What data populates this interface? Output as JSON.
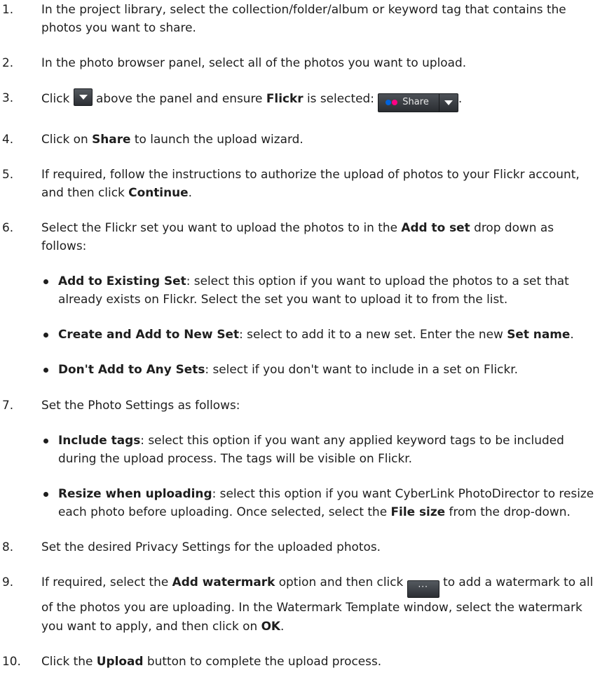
{
  "steps": [
    {
      "number": "1.",
      "text": "In the project library, select the collection/folder/album or keyword tag that contains the photos you want to share."
    },
    {
      "number": "2.",
      "text": "In the photo browser panel, select all of the photos you want to upload."
    },
    {
      "number": "3.",
      "pre": "Click",
      "mid": "above the panel and ensure",
      "bold": "Flickr",
      "post": "is selected:",
      "end": "."
    },
    {
      "number": "4.",
      "pre": "Click on",
      "bold": "Share",
      "post": "to launch the upload wizard."
    },
    {
      "number": "5.",
      "pre": "If required, follow the instructions to authorize the upload of photos to your Flickr account, and then click",
      "bold": "Continue",
      "post": "."
    },
    {
      "number": "6.",
      "pre": "Select the Flickr set you want to upload the photos to in the",
      "bold": "Add to set",
      "post": "drop down as follows:"
    },
    {
      "number": "7.",
      "text": "Set the Photo Settings as follows:"
    },
    {
      "number": "8.",
      "text": "Set the desired Privacy Settings for the uploaded photos."
    },
    {
      "number": "9.",
      "pre": "If required, select the",
      "bold": "Add watermark",
      "mid": "option and then click",
      "post": "to add a watermark to all of the photos you are uploading. In the Watermark Template window, select the watermark you want to apply, and then click on",
      "bold2": "OK",
      "end": "."
    },
    {
      "number": "10.",
      "pre": "Click the",
      "bold": "Upload",
      "post": "button to complete the upload process."
    }
  ],
  "set_options": [
    {
      "bold": "Add to Existing Set",
      "text": ": select this option if you want to upload the photos to a set that already exists on Flickr. Select the set you want to upload it to from the list."
    },
    {
      "bold": "Create and Add to New Set",
      "text": ": select to add it to a new set. Enter the new",
      "bold2": "Set name",
      "end": "."
    },
    {
      "bold": "Don't Add to Any Sets",
      "text": ": select if you don't want to include in a set on Flickr."
    }
  ],
  "photo_settings": [
    {
      "bold": "Include tags",
      "text": ": select this option if you want any applied keyword tags to be included during the upload process. The tags will be visible on Flickr."
    },
    {
      "bold": "Resize when uploading",
      "text": ": select this option if you want CyberLink PhotoDirector to resize each photo before uploading. Once selected, select the",
      "bold2": "File size",
      "end": " from the drop-down."
    }
  ],
  "share_widget": {
    "label": "Share",
    "flickr_blue": "#0063dc",
    "flickr_pink": "#ff0084"
  },
  "dots_icon_label": "···",
  "icons": {
    "dropdown": "dropdown-arrow-icon",
    "dots": "more-options-icon",
    "bullet": "bullet-dot"
  }
}
